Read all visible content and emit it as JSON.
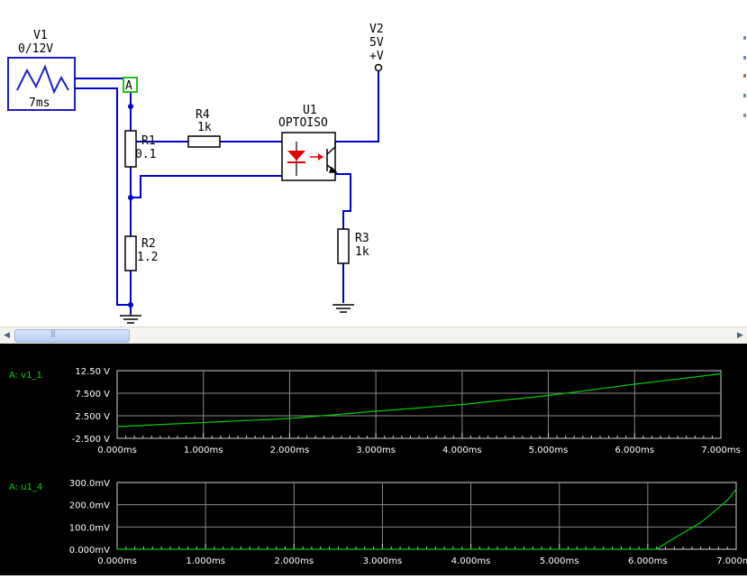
{
  "schematic": {
    "v1": {
      "name": "V1",
      "value": "0/12V",
      "period": "7ms"
    },
    "probe": {
      "label": "A"
    },
    "r1": {
      "name": "R1",
      "value": "0.1"
    },
    "r2": {
      "name": "R2",
      "value": "1.2"
    },
    "r3": {
      "name": "R3",
      "value": "1k"
    },
    "r4": {
      "name": "R4",
      "value": "1k"
    },
    "u1": {
      "name": "U1",
      "part": "OPTOISO"
    },
    "v2": {
      "name": "V2",
      "value": "5V",
      "terminal": "+V"
    }
  },
  "scrollbar": {
    "left_arrow": "◀",
    "right_arrow": "▶",
    "grip": "|||"
  },
  "grapher": {
    "traces": [
      {
        "name": "A: v1_1",
        "yticks": [
          "12.50 V",
          "7.500 V",
          "2.500 V",
          "-2.500 V"
        ]
      },
      {
        "name": "A: u1_4",
        "yticks": [
          "300.0mV",
          "200.0mV",
          "100.0mV",
          "0.000mV"
        ]
      }
    ],
    "xticks": [
      "0.000ms",
      "1.000ms",
      "2.000ms",
      "3.000ms",
      "4.000ms",
      "5.000ms",
      "6.000ms",
      "7.000ms"
    ],
    "trace_color": "#00cc00"
  },
  "chart_data": [
    {
      "type": "line",
      "series": [
        {
          "name": "A: v1_1",
          "x": [
            0,
            1,
            2,
            3,
            4,
            5,
            6,
            7
          ],
          "y": [
            0.1,
            1.0,
            1.9,
            3.5,
            5.0,
            7.0,
            9.5,
            11.8
          ]
        }
      ],
      "xlim": [
        0,
        7
      ],
      "ylim": [
        -2.5,
        12.5
      ],
      "xlabel": "",
      "ylabel": "",
      "grid": true
    },
    {
      "type": "line",
      "series": [
        {
          "name": "A: u1_4",
          "x": [
            0,
            1,
            2,
            3,
            4,
            5,
            6.1,
            6.3,
            6.6,
            6.9,
            7.0
          ],
          "y": [
            0,
            0,
            0,
            0,
            0,
            0,
            0,
            50,
            120,
            220,
            270
          ]
        }
      ],
      "xlim": [
        0,
        7
      ],
      "ylim": [
        0,
        300
      ],
      "xlabel": "",
      "ylabel": "",
      "grid": true
    }
  ]
}
